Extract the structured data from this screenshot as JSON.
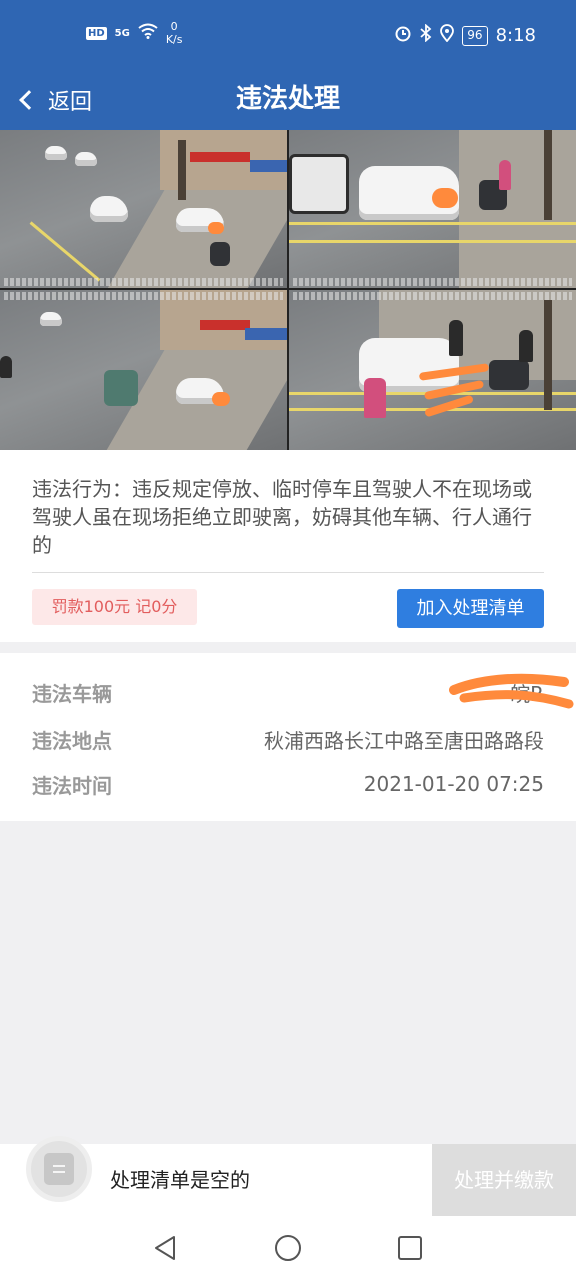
{
  "status_bar": {
    "hd": "HD",
    "signal": "5G",
    "net_speed_value": "0",
    "net_speed_unit": "K/s",
    "battery": "96",
    "time": "8:18"
  },
  "header": {
    "back_label": "返回",
    "title": "违法处理"
  },
  "violation": {
    "behavior": "违法行为：违反规定停放、临时停车且驾驶人不在现场或驾驶人虽在现场拒绝立即驶离，妨碍其他车辆、行人通行的",
    "penalty": "罚款100元 记0分",
    "add_button": "加入处理清单"
  },
  "details": {
    "vehicle_label": "违法车辆",
    "vehicle_value": "皖R",
    "location_label": "违法地点",
    "location_value": "秋浦西路长江中路至唐田路路段",
    "time_label": "违法时间",
    "time_value": "2021-01-20 07:25"
  },
  "bottom_bar": {
    "empty_text": "处理清单是空的",
    "pay_button": "处理并缴款"
  }
}
